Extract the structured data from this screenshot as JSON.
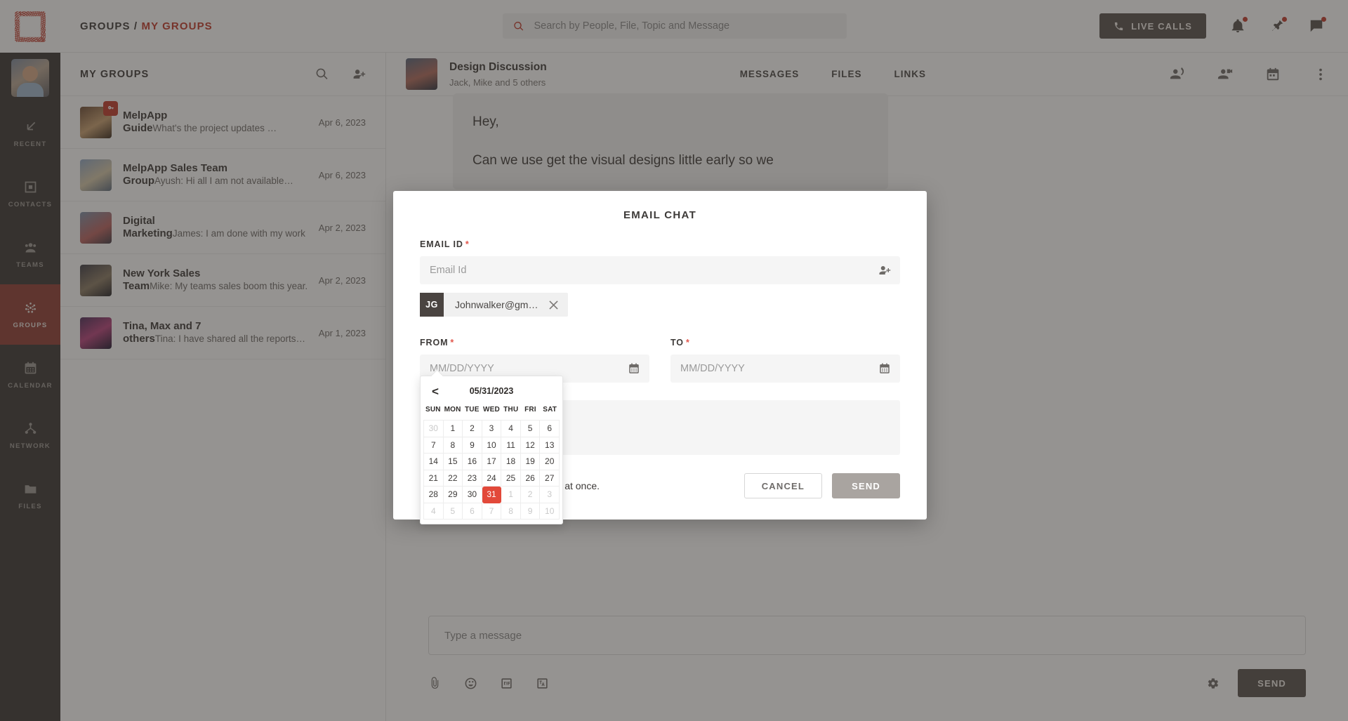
{
  "app": {
    "breadcrumb_root": "GROUPS",
    "breadcrumb_sep": "/",
    "breadcrumb_current": "MY GROUPS",
    "accent_color": "#c0392b",
    "selected_day_color": "#e2493a",
    "rail_active_color": "#8e3b33"
  },
  "header": {
    "search_placeholder": "Search by People, File, Topic and Message",
    "search_value": "",
    "live_calls_label": "LIVE CALLS",
    "icons": [
      "phone-icon",
      "bell-icon",
      "pin-icon",
      "chat-icon"
    ]
  },
  "rail": {
    "items": [
      {
        "label": "RECENT",
        "icon": "arrow-down-left-icon",
        "active": false
      },
      {
        "label": "CONTACTS",
        "icon": "contact-card-icon",
        "active": false
      },
      {
        "label": "TEAMS",
        "icon": "people-icon",
        "active": false
      },
      {
        "label": "GROUPS",
        "icon": "group-dots-icon",
        "active": true
      },
      {
        "label": "CALENDAR",
        "icon": "calendar-icon",
        "active": false
      },
      {
        "label": "NETWORK",
        "icon": "network-icon",
        "active": false
      },
      {
        "label": "FILES",
        "icon": "folder-icon",
        "active": false
      }
    ]
  },
  "list_panel": {
    "title": "MY GROUPS",
    "search_icon": "search-icon",
    "add_member_icon": "add-member-icon",
    "groups": [
      {
        "name": "MelpApp Guide",
        "preview": "What's the project updates …",
        "date": "Apr 6, 2023",
        "locked": true
      },
      {
        "name": "MelpApp Sales Team Group",
        "preview": "Ayush: Hi all I am not available…",
        "date": "Apr 6, 2023",
        "locked": false
      },
      {
        "name": "Digital Marketing",
        "preview": "James: I am done with my work",
        "date": "Apr 2, 2023",
        "locked": false
      },
      {
        "name": "New York Sales Team",
        "preview": "Mike: My teams sales boom this year.",
        "date": "Apr 2, 2023",
        "locked": false
      },
      {
        "name": "Tina, Max and 7 others",
        "preview": "Tina: I have shared all the reports…",
        "date": "Apr 1, 2023",
        "locked": false
      }
    ]
  },
  "conversation": {
    "title": "Design Discussion",
    "subtitle": "Jack, Mike and 5 others",
    "tabs": [
      {
        "label": "MESSAGES",
        "active": true
      },
      {
        "label": "FILES",
        "active": false
      },
      {
        "label": "LINKS",
        "active": false
      }
    ],
    "action_icons": [
      "audio-call-icon",
      "video-call-icon",
      "calendar-icon",
      "more-vertical-icon"
    ],
    "message_line_1": "Hey,",
    "message_line_2": "Can we use get the visual designs little early so we",
    "composer": {
      "placeholder": "Type a message",
      "value": "",
      "tool_icons": [
        "attachment-icon",
        "emoji-icon",
        "gif-icon",
        "translate-icon"
      ],
      "settings_icon": "gear-icon",
      "send_label": "SEND"
    }
  },
  "modal": {
    "title": "EMAIL CHAT",
    "email_label": "EMAIL ID",
    "email_placeholder": "Email Id",
    "email_value": "",
    "email_picker_icon": "add-contact-icon",
    "chip": {
      "initials": "JG",
      "email": "Johnwalker@gmai…",
      "remove_icon": "close-icon"
    },
    "from_label": "FROM",
    "from_placeholder": "MM/DD/YYYY",
    "from_value": "",
    "to_label": "TO",
    "to_placeholder": "MM/DD/YYYY",
    "to_value": "",
    "calendar_icon": "calendar-icon",
    "required_mark": "*",
    "footer_note": "Maximum 5 person can be email at once.",
    "cancel_label": "CANCEL",
    "send_label": "SEND"
  },
  "datepicker": {
    "prev_label": "<",
    "header_date": "05/31/2023",
    "dow": [
      "SUN",
      "MON",
      "TUE",
      "WED",
      "THU",
      "FRI",
      "SAT"
    ],
    "weeks": [
      [
        {
          "d": "30",
          "mute": true
        },
        {
          "d": "1"
        },
        {
          "d": "2"
        },
        {
          "d": "3"
        },
        {
          "d": "4"
        },
        {
          "d": "5"
        },
        {
          "d": "6"
        }
      ],
      [
        {
          "d": "7"
        },
        {
          "d": "8"
        },
        {
          "d": "9"
        },
        {
          "d": "10"
        },
        {
          "d": "11"
        },
        {
          "d": "12"
        },
        {
          "d": "13"
        }
      ],
      [
        {
          "d": "14"
        },
        {
          "d": "15"
        },
        {
          "d": "16"
        },
        {
          "d": "17"
        },
        {
          "d": "18"
        },
        {
          "d": "19"
        },
        {
          "d": "20"
        }
      ],
      [
        {
          "d": "21"
        },
        {
          "d": "22"
        },
        {
          "d": "23"
        },
        {
          "d": "24"
        },
        {
          "d": "25"
        },
        {
          "d": "26"
        },
        {
          "d": "27"
        }
      ],
      [
        {
          "d": "28"
        },
        {
          "d": "29"
        },
        {
          "d": "30"
        },
        {
          "d": "31",
          "selected": true
        },
        {
          "d": "1",
          "mute": true
        },
        {
          "d": "2",
          "mute": true
        },
        {
          "d": "3",
          "mute": true
        }
      ],
      [
        {
          "d": "4",
          "mute": true
        },
        {
          "d": "5",
          "mute": true
        },
        {
          "d": "6",
          "mute": true
        },
        {
          "d": "7",
          "mute": true
        },
        {
          "d": "8",
          "mute": true
        },
        {
          "d": "9",
          "mute": true
        },
        {
          "d": "10",
          "mute": true
        }
      ]
    ]
  }
}
